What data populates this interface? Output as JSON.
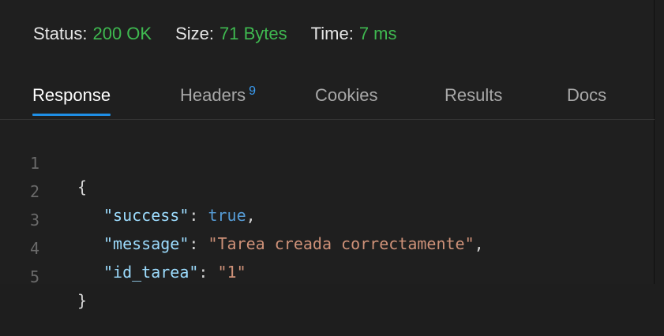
{
  "status": {
    "status_label": "Status:",
    "status_value": "200 OK",
    "size_label": "Size:",
    "size_value": "71 Bytes",
    "time_label": "Time:",
    "time_value": "7 ms"
  },
  "tabs": [
    {
      "label": "Response",
      "active": true
    },
    {
      "label": "Headers",
      "badge": "9",
      "active": false
    },
    {
      "label": "Cookies",
      "active": false
    },
    {
      "label": "Results",
      "active": false
    },
    {
      "label": "Docs",
      "active": false
    }
  ],
  "response": {
    "line_numbers": [
      "1",
      "2",
      "3",
      "4",
      "5"
    ],
    "open_brace": "{",
    "close_brace": "}",
    "fields": [
      {
        "key": "\"success\"",
        "value": "true",
        "type": "boolean",
        "trailing": ","
      },
      {
        "key": "\"message\"",
        "value": "\"Tarea creada correctamente\"",
        "type": "string",
        "trailing": ","
      },
      {
        "key": "\"id_tarea\"",
        "value": "\"1\"",
        "type": "string",
        "trailing": ""
      }
    ]
  },
  "colors": {
    "status_value": "#3fb950",
    "active_tab_underline": "#1f8fe6",
    "badge": "#3a9cf2",
    "json_key": "#9cdcfe",
    "json_string": "#ce9178",
    "json_boolean": "#569cd6"
  }
}
